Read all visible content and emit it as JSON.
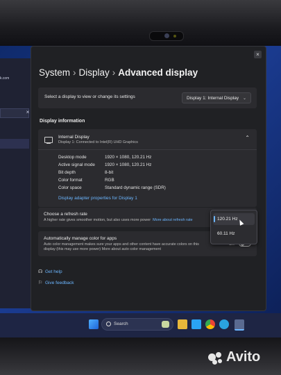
{
  "background_window": {
    "url_fragment": "k.com",
    "close_glyph": "×"
  },
  "window": {
    "close_glyph": "×",
    "breadcrumb": {
      "part1": "System",
      "part2": "Display",
      "current": "Advanced display",
      "separator": "›"
    }
  },
  "select_display": {
    "label": "Select a display to view or change its settings",
    "value": "Display 1: Internal Display"
  },
  "display_info": {
    "section_title": "Display information",
    "name": "Internal Display",
    "connection": "Display 1: Connected to Intel(R) UHD Graphics",
    "specs": [
      {
        "label": "Desktop mode",
        "value": "1920 × 1080, 120.21 Hz"
      },
      {
        "label": "Active signal mode",
        "value": "1920 × 1080, 120.21 Hz"
      },
      {
        "label": "Bit depth",
        "value": "8-bit"
      },
      {
        "label": "Color format",
        "value": "RGB"
      },
      {
        "label": "Color space",
        "value": "Standard dynamic range (SDR)"
      }
    ],
    "adapter_link": "Display adapter properties for Display 1"
  },
  "refresh_rate": {
    "title": "Choose a refresh rate",
    "description": "A higher rate gives smoother motion, but also uses more power",
    "link": "More about refresh rate",
    "options": [
      "120.21 Hz",
      "60.11 Hz"
    ],
    "selected": "120.21 Hz"
  },
  "auto_color": {
    "title": "Automatically manage color for apps",
    "description": "Auto color management makes sure your apps and other content have accurate colors on this display (this may use more power) More about auto color management",
    "toggle_label": "Off"
  },
  "help_links": {
    "get_help": "Get help",
    "give_feedback": "Give feedback"
  },
  "taskbar": {
    "search_label": "Search"
  },
  "watermark": "Avito",
  "colors": {
    "accent": "#6cb6ff",
    "window_bg": "#202124",
    "card_bg": "#2b2b2f",
    "desktop": "#1b3c92"
  }
}
